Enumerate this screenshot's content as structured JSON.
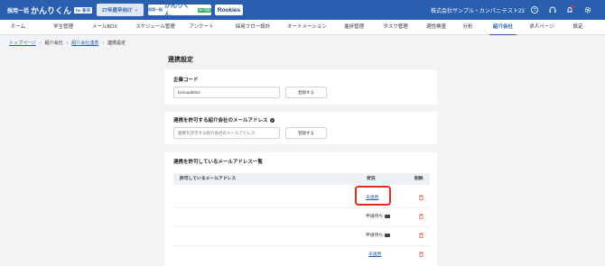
{
  "header": {
    "logo_prefix": "採用一括",
    "logo_name": "かんりくん",
    "logo_badge": "for 新卒",
    "year_select": "27年度卒向け",
    "brand2_prefix": "採用一括",
    "brand2_name": "かんりくん",
    "brand2_badge": "for 中途",
    "rookies": "Rookies",
    "company": "株式会社サンプル・カンパニー",
    "user": "テスト23",
    "icons": [
      "help-circle-icon",
      "headset-icon",
      "bell-icon",
      "gear-icon"
    ]
  },
  "nav": {
    "items": [
      "ホーム",
      "学生管理",
      "メールBOX",
      "スケジュール管理",
      "アンケート",
      "採用フロー設計",
      "オートメーション",
      "進捗管理",
      "タスク管理",
      "適性検査",
      "分析",
      "紹介会社",
      "求人ページ",
      "設定"
    ],
    "active": "紹介会社"
  },
  "breadcrumb": {
    "items": [
      "トップページ",
      "紹介会社",
      "紹介会社連携",
      "連携設定"
    ]
  },
  "page": {
    "title": "連携設定"
  },
  "company_code": {
    "label": "企業コード",
    "value": "hrcloud2024",
    "button": "登録する"
  },
  "allow_email": {
    "label": "連携を許可する紹介会社のメールアドレス",
    "placeholder": "連携を許可する紹介会社のメールアドレス",
    "button": "登録する"
  },
  "allowed_list": {
    "label": "連携を許可しているメールアドレス一覧",
    "columns": {
      "email": "許可しているメールアドレス",
      "status": "状況",
      "delete": "削除"
    },
    "rows": [
      {
        "status": "未連携",
        "type": "link"
      },
      {
        "status": "申請待ち",
        "type": "pending"
      },
      {
        "status": "申請待ち",
        "type": "pending"
      },
      {
        "status": "未連携",
        "type": "link"
      }
    ]
  },
  "colors": {
    "primary": "#2a5fb0",
    "highlight": "#e22b1c",
    "delete": "#e74c3c"
  }
}
